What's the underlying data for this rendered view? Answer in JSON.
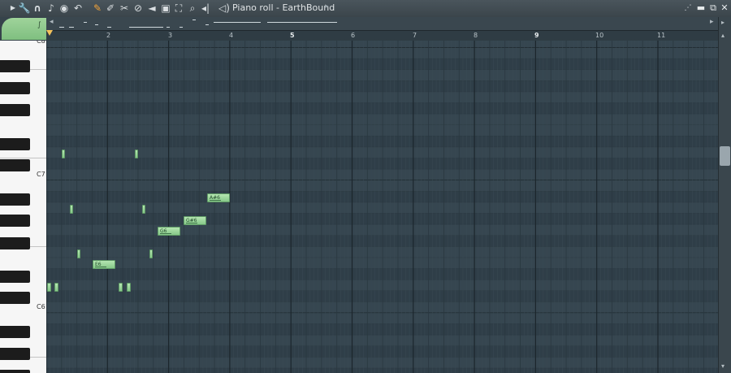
{
  "window": {
    "title": "Piano roll - EarthBound"
  },
  "tools": [
    "arrow-menu-icon",
    "wrench-icon",
    "magnet-icon",
    "note-icon",
    "stamp-icon",
    "undo-icon",
    "pencil-icon",
    "brush-icon",
    "delete-icon",
    "mute-icon",
    "slice-icon",
    "select-icon",
    "zoom-icon",
    "play-sample-icon"
  ],
  "ruler": {
    "bars": [
      {
        "label": "2",
        "major": false
      },
      {
        "label": "3",
        "major": false
      },
      {
        "label": "4",
        "major": false
      },
      {
        "label": "5",
        "major": true
      },
      {
        "label": "6",
        "major": false
      },
      {
        "label": "7",
        "major": false
      },
      {
        "label": "8",
        "major": false
      },
      {
        "label": "9",
        "major": true
      },
      {
        "label": "10",
        "major": false
      },
      {
        "label": "11",
        "major": false
      }
    ]
  },
  "keyboard": {
    "labels": {
      "c7": "C7",
      "c6": "C6",
      "top_partial": "C8"
    }
  },
  "notes": [
    {
      "label": "A#6"
    },
    {
      "label": "G#6"
    },
    {
      "label": "G6"
    },
    {
      "label": "E6"
    }
  ],
  "colors": {
    "note_fill": "#9fd89c",
    "grid_bg": "#34444e",
    "accent": "#f2a43a"
  }
}
